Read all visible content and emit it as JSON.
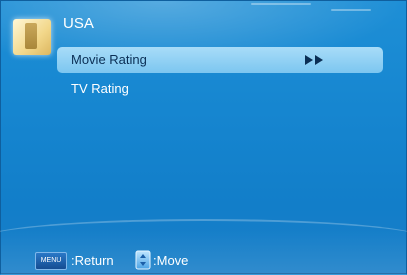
{
  "header": {
    "title": "USA",
    "icon": "region-lock-icon"
  },
  "menu": {
    "items": [
      {
        "label": "Movie Rating",
        "selected": true,
        "has_submenu": true
      },
      {
        "label": "TV Rating",
        "selected": false,
        "has_submenu": false
      }
    ]
  },
  "footer": {
    "menu_key": "MENU",
    "return_label": ":Return",
    "move_label": ":Move"
  },
  "colors": {
    "background": "#1686d0",
    "selection": "#7cc6f0",
    "text": "#ffffff"
  }
}
